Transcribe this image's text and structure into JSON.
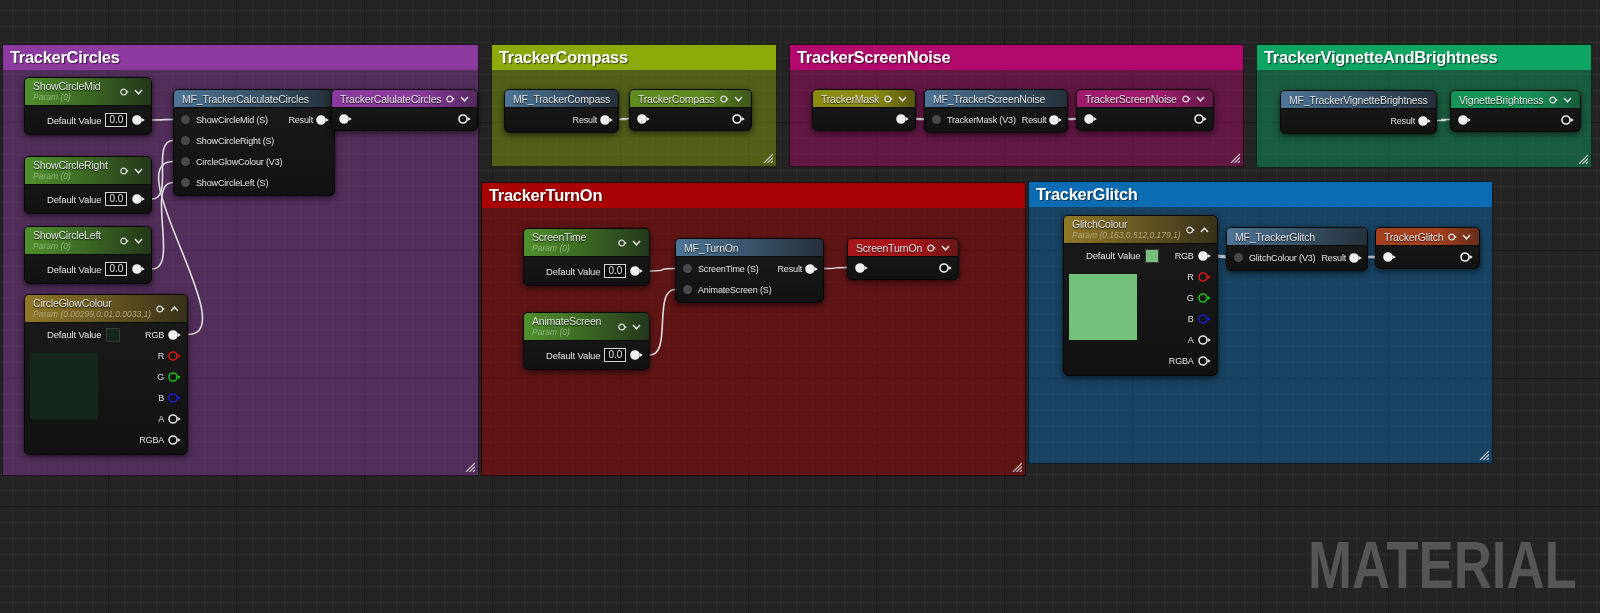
{
  "comment_boxes": [
    {
      "title": "TrackerCircles",
      "color": "#8e3ba1",
      "nodes": [
        {
          "kind": "scalar_parameter",
          "title": "ShowCircleMid",
          "subtitle": "Param (0)",
          "expanded": false,
          "default_label": "Default Value",
          "default_value": "0.0",
          "output": {
            "connected": true
          }
        },
        {
          "kind": "scalar_parameter",
          "title": "ShowCircleRight",
          "subtitle": "Param (0)",
          "expanded": false,
          "default_label": "Default Value",
          "default_value": "0.0",
          "output": {
            "connected": true
          }
        },
        {
          "kind": "scalar_parameter",
          "title": "ShowCircleLeft",
          "subtitle": "Param (0)",
          "expanded": false,
          "default_label": "Default Value",
          "default_value": "0.0",
          "output": {
            "connected": true
          }
        },
        {
          "kind": "vector_parameter",
          "title": "CircleGlowColour",
          "subtitle": "Param (0.00299,0.01,0.0033,1)",
          "expanded": true,
          "default_label": "Default Value",
          "color": "#13271a",
          "outputs": [
            {
              "label": "RGB",
              "color": "#f0f0f0",
              "connected": true
            },
            {
              "label": "R",
              "color": "#d81818",
              "connected": false
            },
            {
              "label": "G",
              "color": "#1fbf1f",
              "connected": false
            },
            {
              "label": "B",
              "color": "#1c1cc8",
              "connected": false
            },
            {
              "label": "A",
              "color": "#e0e0e0",
              "connected": false
            },
            {
              "label": "RGBA",
              "color": "#e0e0e0",
              "connected": false
            }
          ]
        },
        {
          "kind": "function_call",
          "title": "MF_TrackerCalculateCircles",
          "inputs": [
            {
              "label": "ShowCircleMid (S)",
              "connected": true
            },
            {
              "label": "ShowCircleRight (S)",
              "connected": true
            },
            {
              "label": "CircleGlowColour (V3)",
              "connected": true
            },
            {
              "label": "ShowCircleLeft (S)",
              "connected": true
            }
          ],
          "outputs": [
            {
              "label": "Result",
              "connected": true
            }
          ]
        },
        {
          "kind": "reroute_declaration",
          "title": "TrackerCalulateCircles",
          "color": "#8a3a9c",
          "expanded": false,
          "input": {
            "connected": true
          },
          "output": {
            "connected": false
          }
        }
      ]
    },
    {
      "title": "TrackerCompass",
      "color": "#8cab0b",
      "nodes": [
        {
          "kind": "function_call",
          "title": "MF_TrackerCompass",
          "outputs": [
            {
              "label": "Result",
              "connected": true
            }
          ]
        },
        {
          "kind": "reroute_declaration",
          "title": "TrackerCompass",
          "color": "#5f8a1e",
          "expanded": false,
          "input": {
            "connected": true
          },
          "output": {
            "connected": false
          }
        }
      ]
    },
    {
      "title": "TrackerScreenNoise",
      "color": "#b10a6c",
      "nodes": [
        {
          "kind": "reroute_usage",
          "title": "TrackerMask",
          "color": "#8b8b12",
          "expanded": false,
          "output": {
            "connected": true
          }
        },
        {
          "kind": "function_call",
          "title": "MF_TrackerScreenNoise",
          "inputs": [
            {
              "label": "TrackerMask (V3)",
              "connected": true
            }
          ],
          "outputs": [
            {
              "label": "Result",
              "connected": true
            }
          ]
        },
        {
          "kind": "reroute_declaration",
          "title": "TrackerScreenNoise",
          "color": "#9e1a6c",
          "expanded": false,
          "input": {
            "connected": true
          },
          "output": {
            "connected": false
          }
        }
      ]
    },
    {
      "title": "TrackerVignetteAndBrightness",
      "color": "#0ea462",
      "nodes": [
        {
          "kind": "function_call",
          "title": "MF_TrackerVignetteBrightness",
          "outputs": [
            {
              "label": "Result",
              "connected": true
            }
          ]
        },
        {
          "kind": "reroute_declaration",
          "title": "VignetteBrightness",
          "color": "#16955a",
          "expanded": false,
          "input": {
            "connected": true
          },
          "output": {
            "connected": false
          }
        }
      ]
    },
    {
      "title": "TrackerTurnOn",
      "color": "#aa0202",
      "nodes": [
        {
          "kind": "scalar_parameter",
          "title": "ScreenTime",
          "subtitle": "Param (0)",
          "expanded": false,
          "default_label": "Default Value",
          "default_value": "0.0",
          "output": {
            "connected": true
          }
        },
        {
          "kind": "scalar_parameter",
          "title": "AnimateScreen",
          "subtitle": "Param (0)",
          "expanded": false,
          "default_label": "Default Value",
          "default_value": "0.0",
          "output": {
            "connected": true
          }
        },
        {
          "kind": "function_call",
          "title": "MF_TurnOn",
          "inputs": [
            {
              "label": "ScreenTime (S)",
              "connected": true
            },
            {
              "label": "AnimateScreen (S)",
              "connected": true
            }
          ],
          "outputs": [
            {
              "label": "Result",
              "connected": true
            }
          ]
        },
        {
          "kind": "reroute_declaration",
          "title": "ScreenTurnOn",
          "color": "#a8161a",
          "expanded": false,
          "input": {
            "connected": true
          },
          "output": {
            "connected": false
          }
        }
      ]
    },
    {
      "title": "TrackerGlitch",
      "color": "#0b6cb4",
      "nodes": [
        {
          "kind": "vector_parameter",
          "title": "GlitchColour",
          "subtitle": "Param (0.163,0.512,0.179,1)",
          "expanded": true,
          "default_label": "Default Value",
          "color": "#74c27a",
          "outputs": [
            {
              "label": "RGB",
              "color": "#f0f0f0",
              "connected": true
            },
            {
              "label": "R",
              "color": "#d81818",
              "connected": false
            },
            {
              "label": "G",
              "color": "#1fbf1f",
              "connected": false
            },
            {
              "label": "B",
              "color": "#1c1cc8",
              "connected": false
            },
            {
              "label": "A",
              "color": "#e0e0e0",
              "connected": false
            },
            {
              "label": "RGBA",
              "color": "#e0e0e0",
              "connected": false
            }
          ]
        },
        {
          "kind": "function_call",
          "title": "MF_TrackerGlitch",
          "inputs": [
            {
              "label": "GlitchColour (V3)",
              "connected": true
            }
          ],
          "outputs": [
            {
              "label": "Result",
              "connected": true
            }
          ]
        },
        {
          "kind": "reroute_declaration",
          "title": "TrackerGlitch",
          "color": "#a5401e",
          "expanded": false,
          "input": {
            "connected": true
          },
          "output": {
            "connected": false
          }
        }
      ]
    }
  ],
  "graph_type_label": "MATERIAL"
}
